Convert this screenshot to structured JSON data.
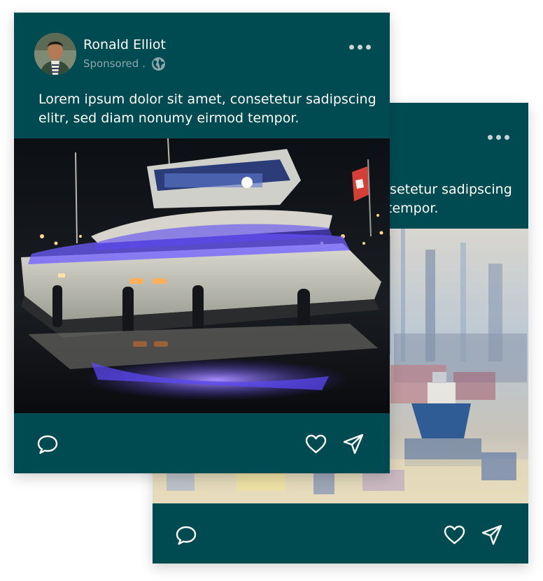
{
  "back_card": {
    "text_line1": "nsetetur sadipscing",
    "text_line2": "tempor.",
    "image_icon": "painting-boats-image"
  },
  "front_card": {
    "author": "Ronald Elliot",
    "sponsored": "Sponsored .",
    "globe_icon": "globe-icon",
    "text_line1": "Lorem ipsum dolor sit amet, consetetur sadipscing",
    "text_line2": "elitr, sed diam nonumy eirmod tempor.",
    "image_icon": "yacht-photo"
  },
  "icons": {
    "comment": "comment-icon",
    "like": "heart-icon",
    "share": "send-icon",
    "more": "more-options-icon"
  },
  "colors": {
    "card": "#004b52",
    "text": "#ffffff",
    "muted": "#8ea7aa"
  }
}
